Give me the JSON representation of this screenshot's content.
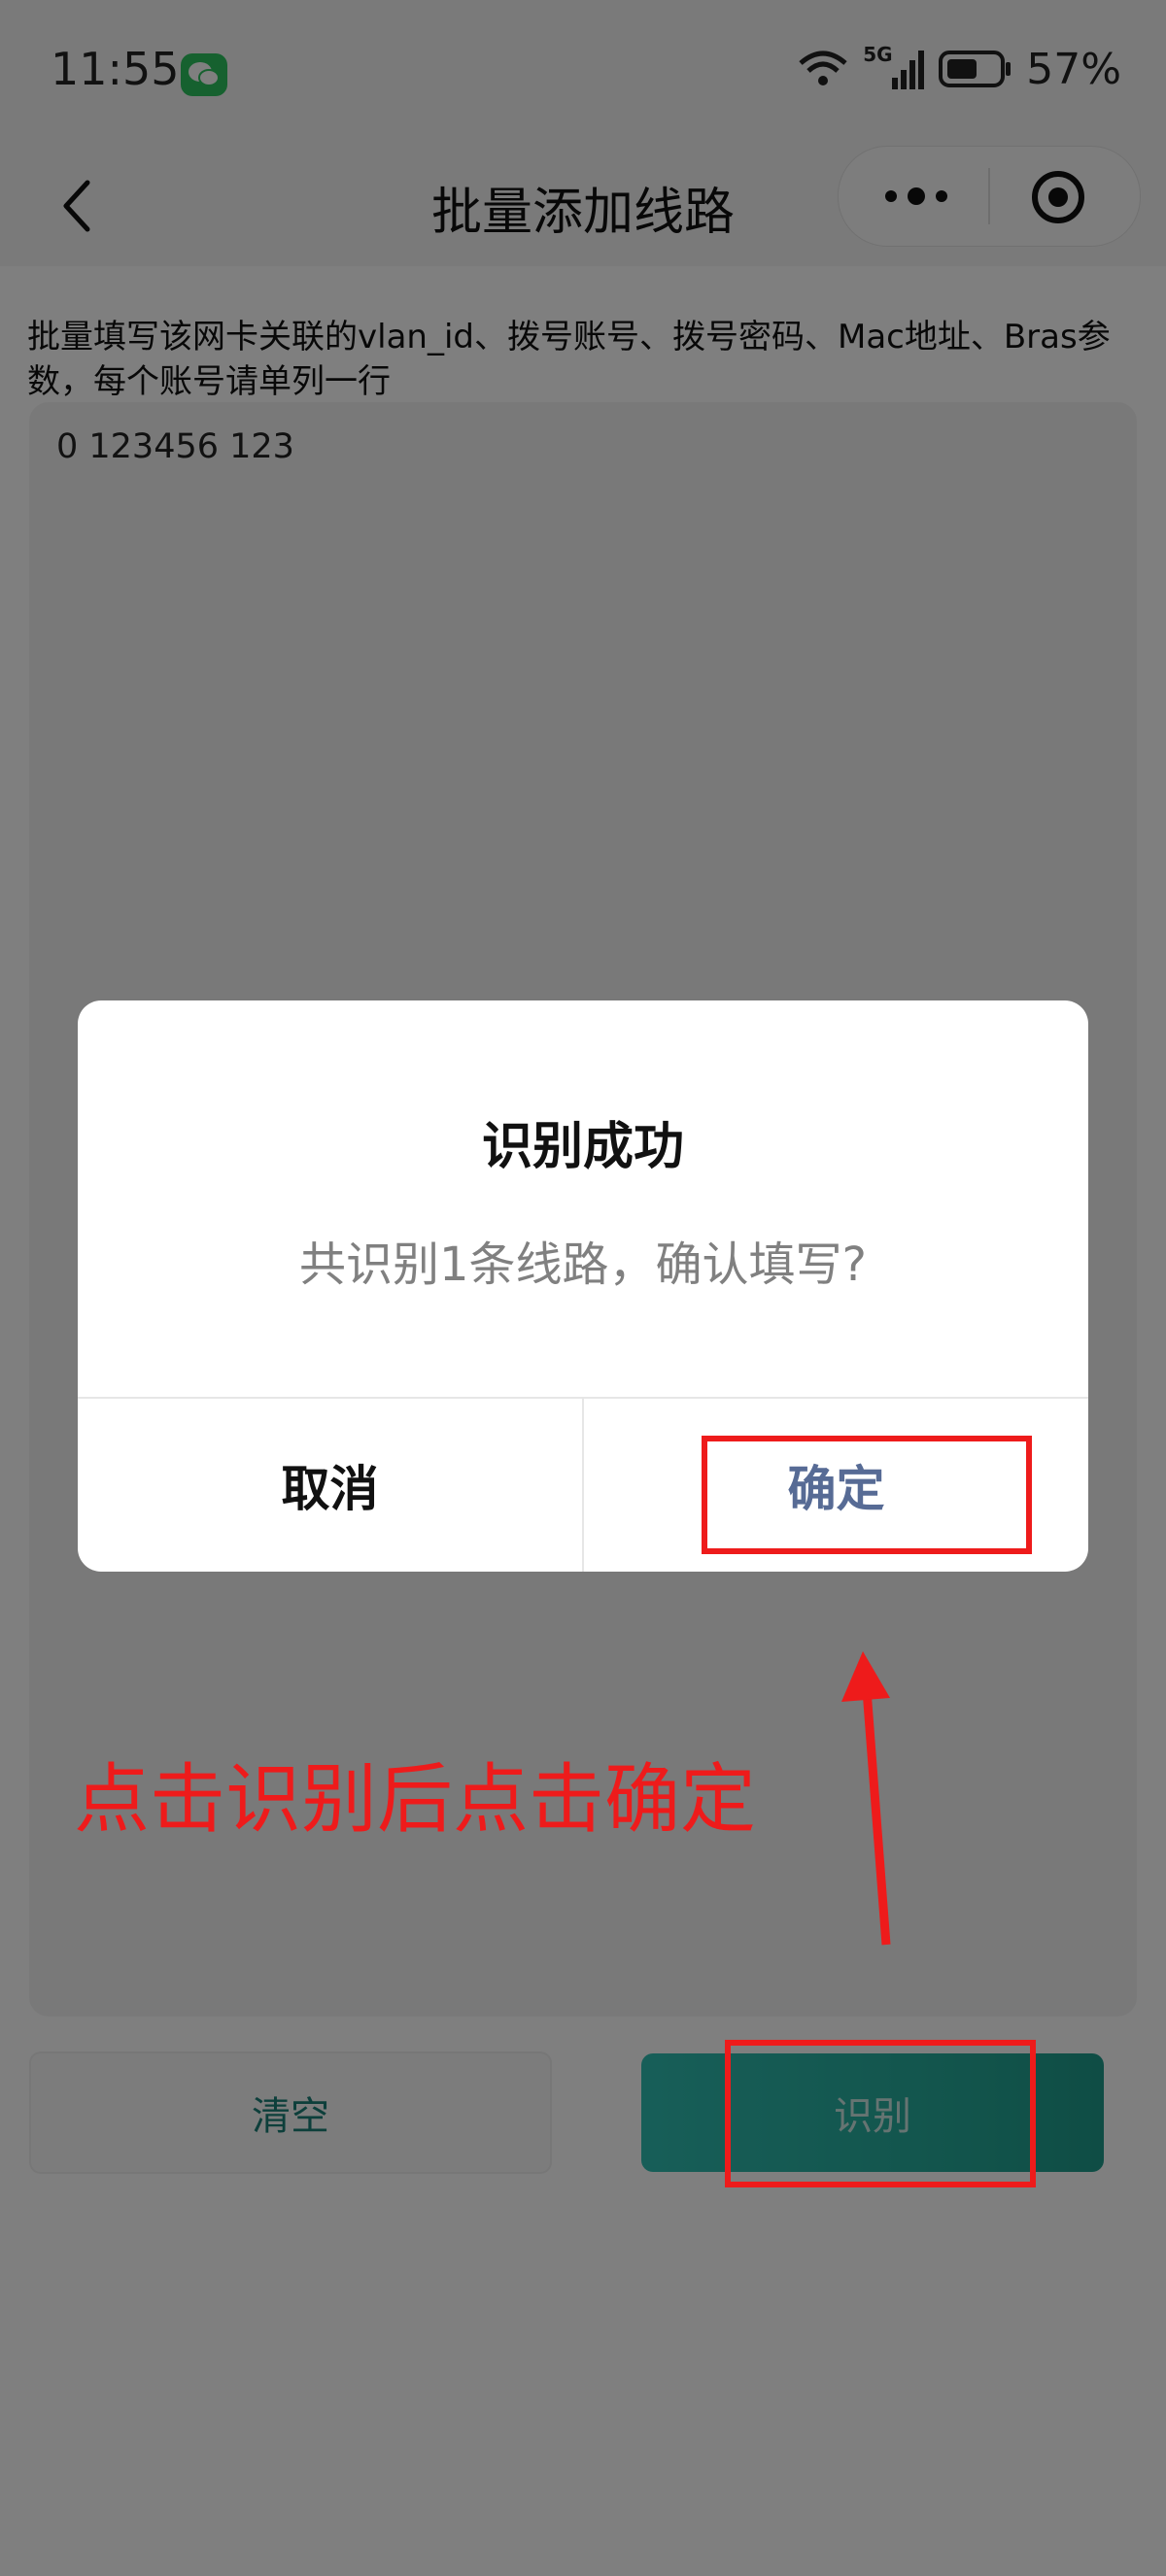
{
  "status_bar": {
    "time": "11:55",
    "network": "5G",
    "battery": "57%",
    "icons": [
      "wechat-icon",
      "wifi-icon",
      "signal-icon",
      "battery-icon"
    ]
  },
  "nav": {
    "title": "批量添加线路",
    "back_icon": "chevron-left-icon",
    "more_icon": "more-dots-icon",
    "close_icon": "target-icon"
  },
  "form": {
    "instruction": "批量填写该网卡关联的vlan_id、拨号账号、拨号密码、Mac地址、Bras参数，每个账号请单列一行",
    "textarea_value": "0 123456 123"
  },
  "buttons": {
    "clear": "清空",
    "recognize": "识别"
  },
  "dialog": {
    "title": "识别成功",
    "message": "共识别1条线路，确认填写?",
    "cancel": "取消",
    "confirm": "确定"
  },
  "annotation": {
    "text": "点击识别后点击确定",
    "color": "#ee1b1b"
  },
  "colors": {
    "accent": "#25a998",
    "dialog_confirm": "#576b95"
  }
}
